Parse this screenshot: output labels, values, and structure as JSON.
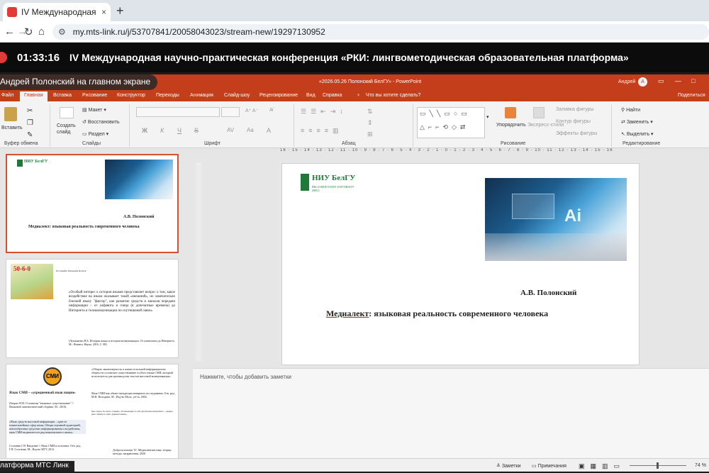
{
  "browser": {
    "tab_title": "IV Международная научно",
    "tab_close": "×",
    "new_tab": "+",
    "url": "my.mts-link.ru/j/53707841/20058043023/stream-new/19297130952",
    "back": "←",
    "forward": "→",
    "reload": "↻",
    "home": "⌂",
    "site_info": "⚙"
  },
  "conference": {
    "timer": "01:33:16",
    "title": "IV Международная научно-практическая конференция «РКИ: лингвометодическая образовательная платформа»"
  },
  "presenter": "Андрей Полонский на главном экране",
  "powerpoint": {
    "doc_title": "«2026.05.26 Полонский БелГУ» - PowerPoint",
    "user": "Андрей",
    "user_initial": "А",
    "tabs": [
      "Файл",
      "Главная",
      "Вставка",
      "Рисование",
      "Конструктор",
      "Переходы",
      "Анимация",
      "Слайд-шоу",
      "Рецензирование",
      "Вид",
      "Справка"
    ],
    "tell_me": "Что вы хотите сделать?",
    "share": "Поделиться",
    "ribbon": {
      "paste": "Вставить",
      "clipboard_group": "Буфер обмена",
      "new_slide": "Создать слайд",
      "layout": "Макет",
      "reset": "Восстановить",
      "section": "Раздел",
      "slides_group": "Слайды",
      "font_group": "Шрифт",
      "paragraph_group": "Абзац",
      "arrange": "Упорядочить",
      "quick_styles": "Экспресс-стили",
      "shape_fill": "Заливка фигуры",
      "shape_outline": "Контур фигуры",
      "shape_effects": "Эффекты фигуры",
      "drawing_group": "Рисование",
      "find": "Найти",
      "replace": "Заменить",
      "select": "Выделить",
      "editing_group": "Редактирование",
      "bold": "Ж",
      "italic": "К",
      "underline": "Ч",
      "strike": "S",
      "spacing": "AV",
      "case": "Aa",
      "font_color": "A"
    },
    "ruler": "16 · 15 · 14 · 13 · 12 · 11 · 10 · 9 · 8 · 7 · 6 · 5 · 4 · 3 · 2 · 1 · 0 · 1 · 2 · 3 · 4 · 5 · 6 · 7 · 8 · 9 · 10 · 11 · 12 · 13 · 14 · 15 · 16",
    "notes_placeholder": "Нажмите, чтобы добавить заметки",
    "status": {
      "notes": "Заметки",
      "comments": "Примечания",
      "zoom": "74 %"
    }
  },
  "slide": {
    "logo_text": "НИУ БелГУ",
    "logo_sub": "BELGOROD STATE UNIVERSITY (BSU)",
    "author": "А.В. Полонский",
    "title_underlined": "Медиалект",
    "title_rest": ": языковая реальность современного человека",
    "image_label": "Ai"
  },
  "thumb2": {
    "header": "50-6-0",
    "small_title": "Послушайте Уважаемые Коллеги",
    "quote": "«Особый интерес к истории языков представляет вопрос о том, какое воздействие на языки оказывает такой «внешний», но замечательно близкий языку \"фактор\", как развитие средств и каналов передачи информации – от алфавита и гонца (в допечатные времена) до Интернета и телекоммуникации по спутниковой связи»",
    "source": "(Лукашанец Н.Б. История языка и история коммуникации. От клинописи до Интернета М.: Флинта; Наука, 2016. С. 88)"
  },
  "thumb3": {
    "badge": "СМИ",
    "left_title": "Язык СМИ – «усредненный язык нации»",
    "left_note": "(Бахрах Н.И. О понятии \"языковое существование\" // Языковой лингвистический сборник. М., 2010).",
    "left_quote": "«Язык средств массовой информации – один из влиятельнейших сфер языка. Общая огромной аудиторией, многообразных средствах информирования и воздействия, язык СМИ выдвигается в ряд национального языка».",
    "left_source": "Солганик Г.Я. Введение // Язык СМИ и политика. Отв. ред. Г.Я. Солганик. М.: Изд-во МГУ, 2012.",
    "right_quote": "«Общую закономерность в жизни тотальной информационно общности составляет существование особого языка СМИ, который используется для производства текстов массовой коммуникации»",
    "right_source": "Язык СМИ как объект междисциплинарного исследования. Отв. ред. М.Н. Володина. М.: Изд-во Моск. ун-та, 2004.",
    "right_mid": "Как следует из самого термина, обозначающего в себе два базовых компонента – «медиа» (масс медиа) и «лект» (вариант языка)...",
    "right_bottom": "Добросклонская Т.Г. Медиалингвистика: теория, методы, направления. 2020."
  },
  "platform_label": "латформа МТС Линк"
}
